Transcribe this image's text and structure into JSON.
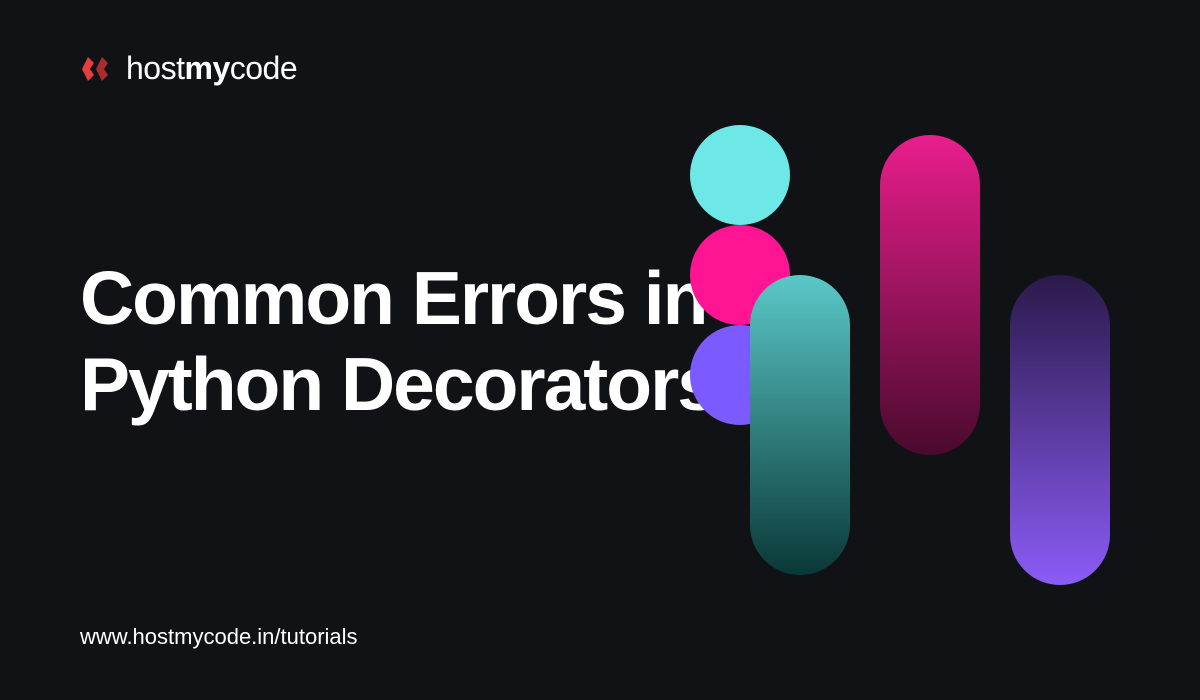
{
  "logo": {
    "prefix": "host",
    "bold": "my",
    "suffix": "code"
  },
  "heading": {
    "line1": "Common Errors in",
    "line2": "Python Decorators"
  },
  "url": "www.hostmycode.in/tutorials"
}
